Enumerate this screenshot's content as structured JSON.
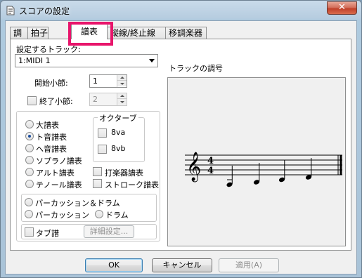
{
  "window": {
    "title": "スコアの設定",
    "close_label": "✕"
  },
  "tabs": [
    {
      "label": "調"
    },
    {
      "label": "拍子"
    },
    {
      "label": "譜表"
    },
    {
      "label": "縦線/終止線"
    },
    {
      "label": "移調楽器"
    }
  ],
  "form": {
    "track_label": "設定するトラック:",
    "track_value": "1:MIDI 1",
    "start_measure_label": "開始小節:",
    "start_measure_value": "1",
    "end_measure_label": "終了小節:",
    "end_measure_value": "2",
    "end_measure_checked": false
  },
  "staff_types": {
    "grand": "大譜表",
    "treble": "ト音譜表",
    "bass": "へ音譜表",
    "soprano": "ソプラノ譜表",
    "alto": "アルト譜表",
    "tenor": "テノール譜表",
    "selected": "treble"
  },
  "octave": {
    "title": "オクターブ",
    "va8": "8va",
    "vb8": "8vb"
  },
  "extra_staff": {
    "percussion": "打楽器譜表",
    "stroke": "ストローク譜表"
  },
  "percussion_group": {
    "perc_drums": "パーカッション＆ドラム",
    "perc": "パーカッション",
    "drums": "ドラム"
  },
  "tab": {
    "label": "タブ譜",
    "details_button": "詳細設定..."
  },
  "preview": {
    "label": "トラックの調号"
  },
  "footer": {
    "ok": "OK",
    "cancel": "キャンセル",
    "apply": "適用(A)"
  },
  "colors": {
    "highlight": "#e8156b"
  }
}
